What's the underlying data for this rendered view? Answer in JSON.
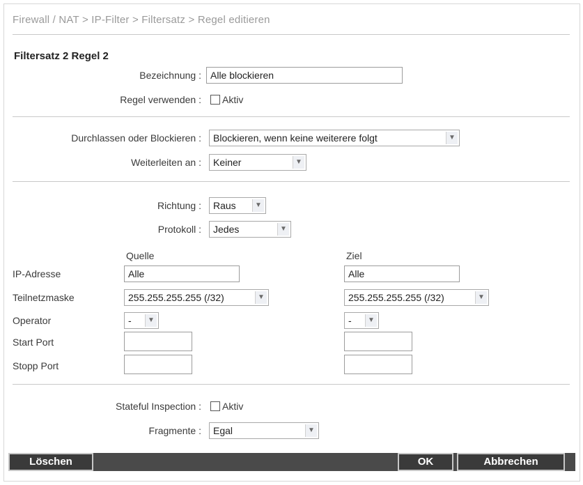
{
  "breadcrumb": "Firewall / NAT > IP-Filter > Filtersatz > Regel editieren",
  "heading": "Filtersatz 2 Regel 2",
  "general": {
    "name_label": "Bezeichnung :",
    "name_value": "Alle blockieren",
    "use_label": "Regel verwenden :",
    "use_checkbox_label": "Aktiv",
    "use_checked": false
  },
  "action": {
    "pass_label": "Durchlassen oder Blockieren :",
    "pass_value": "Blockieren, wenn keine weiterere folgt",
    "forward_label": "Weiterleiten an :",
    "forward_value": "Keiner"
  },
  "traffic": {
    "direction_label": "Richtung :",
    "direction_value": "Raus",
    "protocol_label": "Protokoll :",
    "protocol_value": "Jedes"
  },
  "table": {
    "source_header": "Quelle",
    "dest_header": "Ziel",
    "row_labels": {
      "ip": "IP-Adresse",
      "mask": "Teilnetzmaske",
      "operator": "Operator",
      "start_port": "Start Port",
      "stop_port": "Stopp Port"
    },
    "source": {
      "ip": "Alle",
      "mask": "255.255.255.255 (/32)",
      "operator": "-",
      "start_port": "",
      "stop_port": ""
    },
    "dest": {
      "ip": "Alle",
      "mask": "255.255.255.255 (/32)",
      "operator": "-",
      "start_port": "",
      "stop_port": ""
    }
  },
  "advanced": {
    "stateful_label": "Stateful Inspection :",
    "stateful_checkbox_label": "Aktiv",
    "stateful_checked": false,
    "fragments_label": "Fragmente :",
    "fragments_value": "Egal"
  },
  "buttons": {
    "delete": "Löschen",
    "ok": "OK",
    "cancel": "Abbrechen"
  },
  "icons": {
    "dropdown": "chevron-down-icon"
  },
  "colors": {
    "button_bar": "#4a4a4a",
    "button": "#3a3a3a",
    "separator": "#c8c8c8"
  }
}
